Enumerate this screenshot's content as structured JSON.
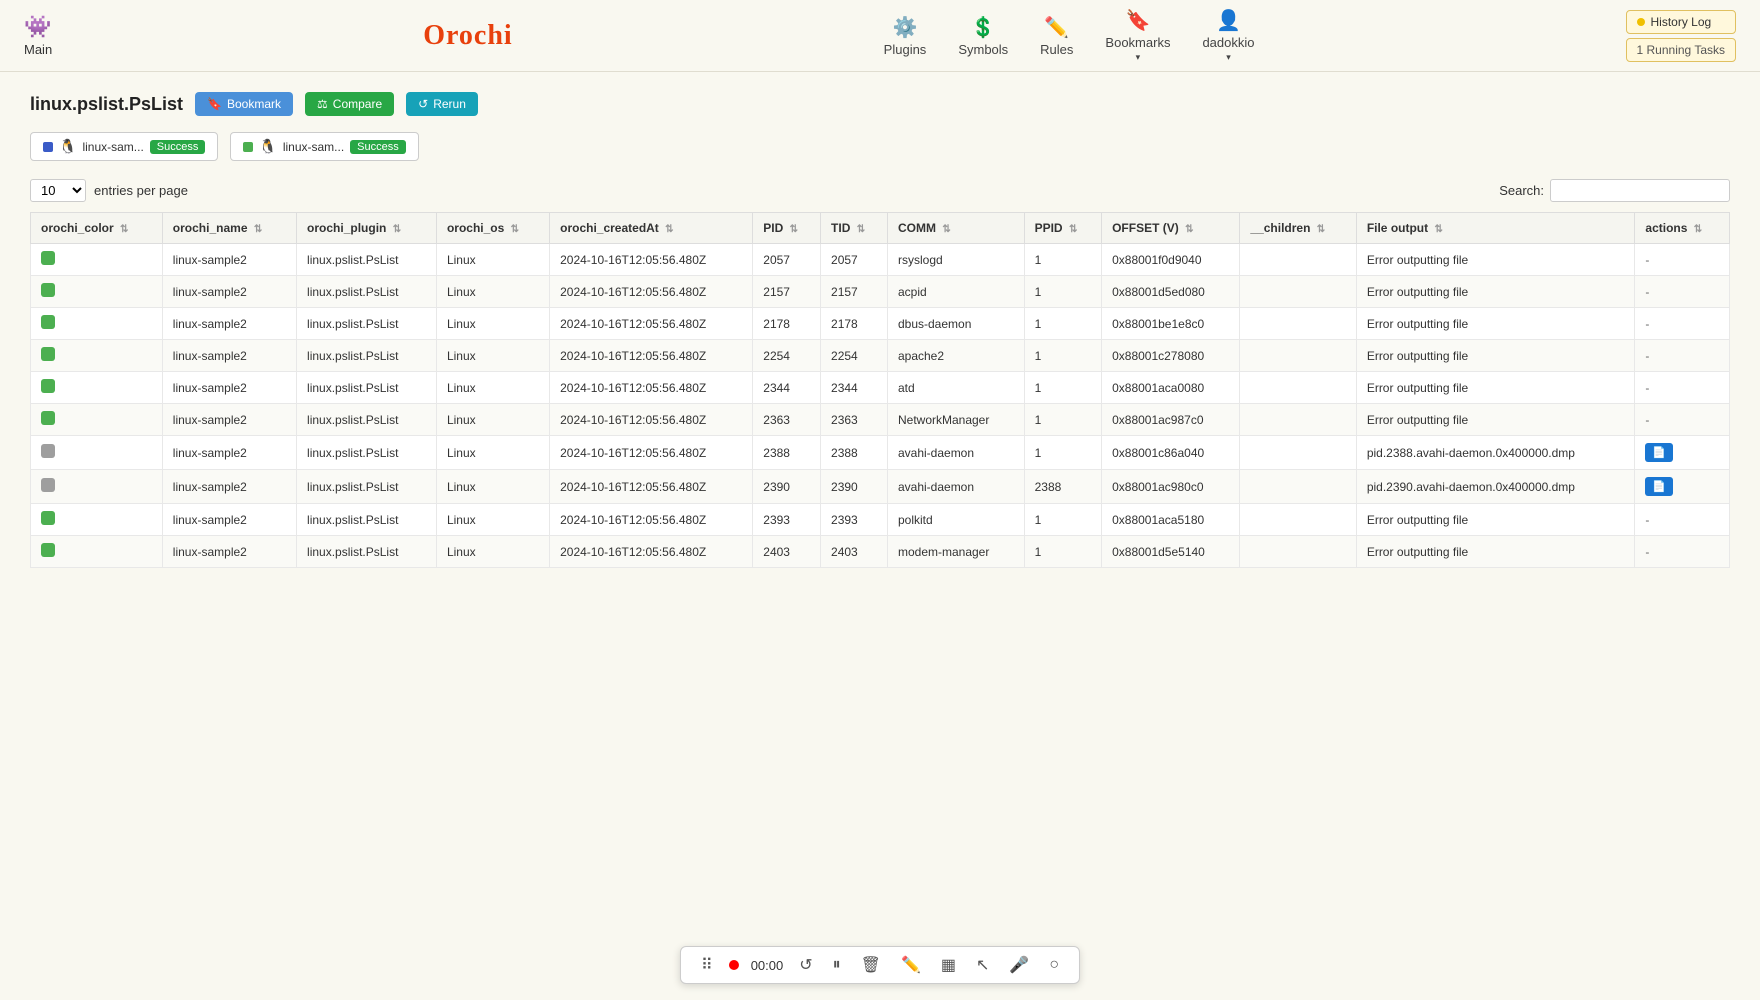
{
  "nav": {
    "main_label": "Main",
    "logo_text": "rochi",
    "logo_prefix": "O",
    "items": [
      {
        "id": "plugins",
        "label": "Plugins",
        "icon": "⚙"
      },
      {
        "id": "symbols",
        "label": "Symbols",
        "icon": "$"
      },
      {
        "id": "rules",
        "label": "Rules",
        "icon": "✏"
      },
      {
        "id": "bookmarks",
        "label": "Bookmarks",
        "icon": "🔖"
      },
      {
        "id": "dadokkio",
        "label": "dadokkio",
        "icon": "👤"
      }
    ],
    "history_label": "History Log",
    "running_label": "1 Running Tasks"
  },
  "page": {
    "title": "linux.pslist.PsList",
    "bookmark_label": "Bookmark",
    "compare_label": "Compare",
    "rerun_label": "Rerun"
  },
  "tabs": [
    {
      "id": "tab1",
      "name": "linux-sam...",
      "badge": "Success",
      "color": "blue"
    },
    {
      "id": "tab2",
      "name": "linux-sam...",
      "badge": "Success",
      "color": "green"
    }
  ],
  "table_controls": {
    "entries_label": "entries per page",
    "entries_value": "10",
    "search_label": "Search:"
  },
  "columns": [
    {
      "id": "orochi_color",
      "label": "orochi_color",
      "sortable": true
    },
    {
      "id": "orochi_name",
      "label": "orochi_name",
      "sortable": true
    },
    {
      "id": "orochi_plugin",
      "label": "orochi_plugin",
      "sortable": true
    },
    {
      "id": "orochi_os",
      "label": "orochi_os",
      "sortable": true
    },
    {
      "id": "orochi_createdAt",
      "label": "orochi_createdAt",
      "sortable": true
    },
    {
      "id": "PID",
      "label": "PID",
      "sortable": true
    },
    {
      "id": "TID",
      "label": "TID",
      "sortable": true
    },
    {
      "id": "COMM",
      "label": "COMM",
      "sortable": true
    },
    {
      "id": "PPID",
      "label": "PPID",
      "sortable": true
    },
    {
      "id": "OFFSET_V",
      "label": "OFFSET (V)",
      "sortable": true
    },
    {
      "id": "_children",
      "label": "__children",
      "sortable": true
    },
    {
      "id": "File_output",
      "label": "File output",
      "sortable": true
    },
    {
      "id": "actions",
      "label": "actions",
      "sortable": true
    }
  ],
  "rows": [
    {
      "color": "green",
      "name": "linux-sample2",
      "plugin": "linux.pslist.PsList",
      "os": "Linux",
      "createdAt": "2024-10-16T12:05:56.480Z",
      "pid": "2057",
      "tid": "2057",
      "comm": "rsyslogd",
      "ppid": "1",
      "offset": "0x88001f0d9040",
      "children": "",
      "file_output": "Error outputting file",
      "has_file": false
    },
    {
      "color": "green",
      "name": "linux-sample2",
      "plugin": "linux.pslist.PsList",
      "os": "Linux",
      "createdAt": "2024-10-16T12:05:56.480Z",
      "pid": "2157",
      "tid": "2157",
      "comm": "acpid",
      "ppid": "1",
      "offset": "0x88001d5ed080",
      "children": "",
      "file_output": "Error outputting file",
      "has_file": false
    },
    {
      "color": "green",
      "name": "linux-sample2",
      "plugin": "linux.pslist.PsList",
      "os": "Linux",
      "createdAt": "2024-10-16T12:05:56.480Z",
      "pid": "2178",
      "tid": "2178",
      "comm": "dbus-daemon",
      "ppid": "1",
      "offset": "0x88001be1e8c0",
      "children": "",
      "file_output": "Error outputting file",
      "has_file": false
    },
    {
      "color": "green",
      "name": "linux-sample2",
      "plugin": "linux.pslist.PsList",
      "os": "Linux",
      "createdAt": "2024-10-16T12:05:56.480Z",
      "pid": "2254",
      "tid": "2254",
      "comm": "apache2",
      "ppid": "1",
      "offset": "0x88001c278080",
      "children": "",
      "file_output": "Error outputting file",
      "has_file": false
    },
    {
      "color": "green",
      "name": "linux-sample2",
      "plugin": "linux.pslist.PsList",
      "os": "Linux",
      "createdAt": "2024-10-16T12:05:56.480Z",
      "pid": "2344",
      "tid": "2344",
      "comm": "atd",
      "ppid": "1",
      "offset": "0x88001aca0080",
      "children": "",
      "file_output": "Error outputting file",
      "has_file": false
    },
    {
      "color": "green",
      "name": "linux-sample2",
      "plugin": "linux.pslist.PsList",
      "os": "Linux",
      "createdAt": "2024-10-16T12:05:56.480Z",
      "pid": "2363",
      "tid": "2363",
      "comm": "NetworkManager",
      "ppid": "1",
      "offset": "0x88001ac987c0",
      "children": "",
      "file_output": "Error outputting file",
      "has_file": false
    },
    {
      "color": "gray",
      "name": "linux-sample2",
      "plugin": "linux.pslist.PsList",
      "os": "Linux",
      "createdAt": "2024-10-16T12:05:56.480Z",
      "pid": "2388",
      "tid": "2388",
      "comm": "avahi-daemon",
      "ppid": "1",
      "offset": "0x88001c86a040",
      "children": "",
      "file_output": "pid.2388.avahi-daemon.0x400000.dmp",
      "has_file": true
    },
    {
      "color": "gray",
      "name": "linux-sample2",
      "plugin": "linux.pslist.PsList",
      "os": "Linux",
      "createdAt": "2024-10-16T12:05:56.480Z",
      "pid": "2390",
      "tid": "2390",
      "comm": "avahi-daemon",
      "ppid": "2388",
      "offset": "0x88001ac980c0",
      "children": "",
      "file_output": "pid.2390.avahi-daemon.0x400000.dmp",
      "has_file": true
    },
    {
      "color": "green",
      "name": "linux-sample2",
      "plugin": "linux.pslist.PsList",
      "os": "Linux",
      "createdAt": "2024-10-16T12:05:56.480Z",
      "pid": "2393",
      "tid": "2393",
      "comm": "polkitd",
      "ppid": "1",
      "offset": "0x88001aca5180",
      "children": "",
      "file_output": "Error outputting file",
      "has_file": false
    },
    {
      "color": "green",
      "name": "linux-sample2",
      "plugin": "linux.pslist.PsList",
      "os": "Linux",
      "createdAt": "2024-10-16T12:05:56.480Z",
      "pid": "2403",
      "tid": "2403",
      "comm": "modem-manager",
      "ppid": "1",
      "offset": "0x88001d5e5140",
      "children": "",
      "file_output": "Error outputting file",
      "has_file": false
    }
  ],
  "toolbar": {
    "timer": "00:00",
    "grid_icon": "▦",
    "draw_icon": "✏",
    "cursor_icon": "↖",
    "mic_icon": "🎤",
    "circle_icon": "○",
    "pause_icon": "⏸",
    "trash_icon": "🗑",
    "refresh_icon": "↺",
    "dots_icon": "⠿"
  }
}
